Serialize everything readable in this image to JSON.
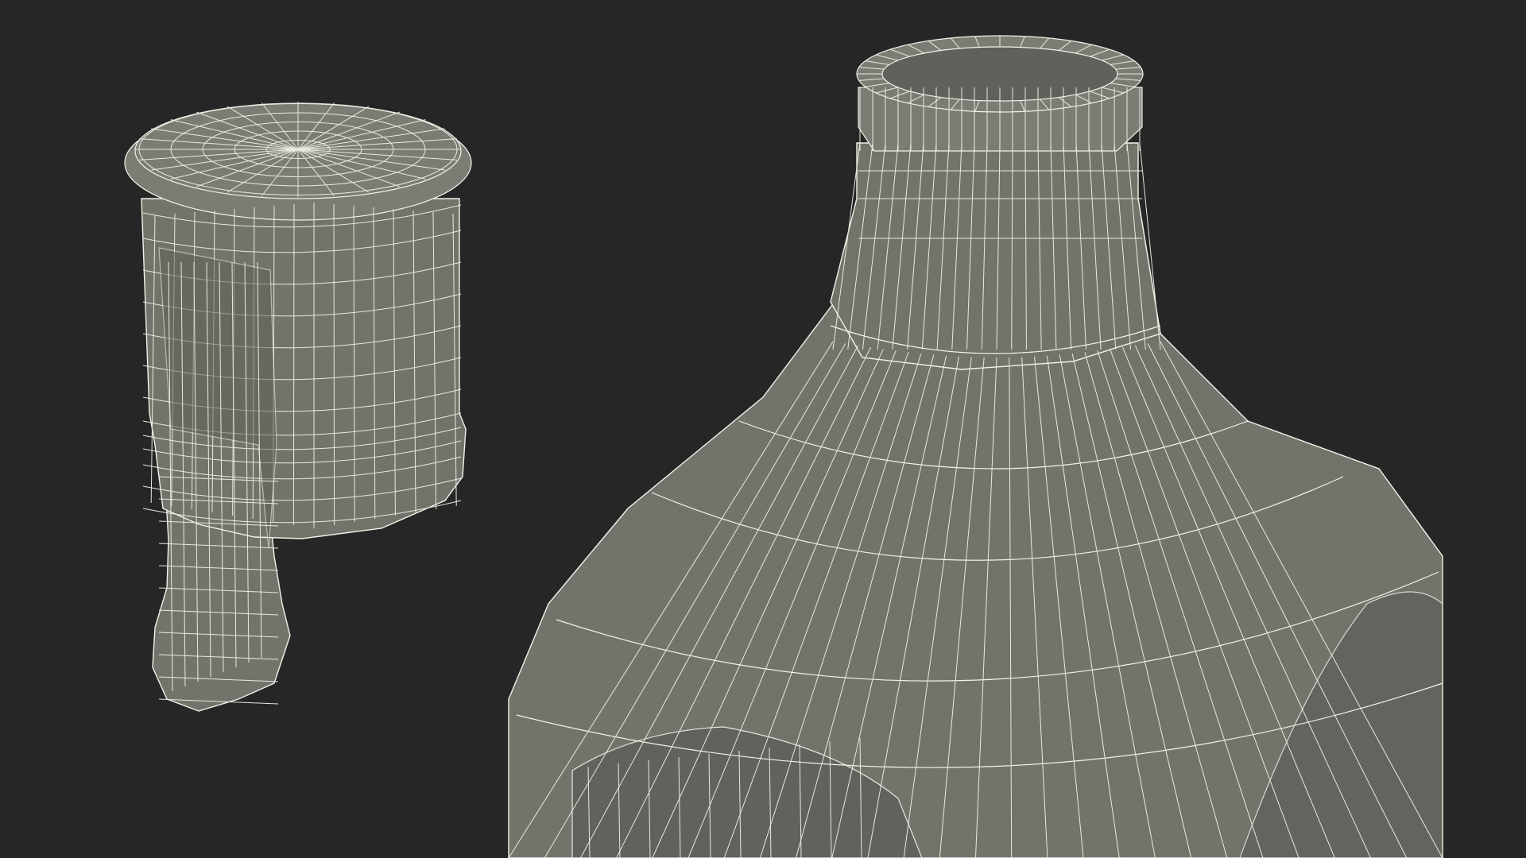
{
  "scene": {
    "background_color": "#262626",
    "mesh_fill_color": "#72746b",
    "wire_color": "#f2f2ea",
    "objects": [
      {
        "name": "bottle-cap-with-tab",
        "style": "wireframe-mesh"
      },
      {
        "name": "bottle-neck-and-shoulder",
        "style": "wireframe-mesh"
      }
    ]
  }
}
